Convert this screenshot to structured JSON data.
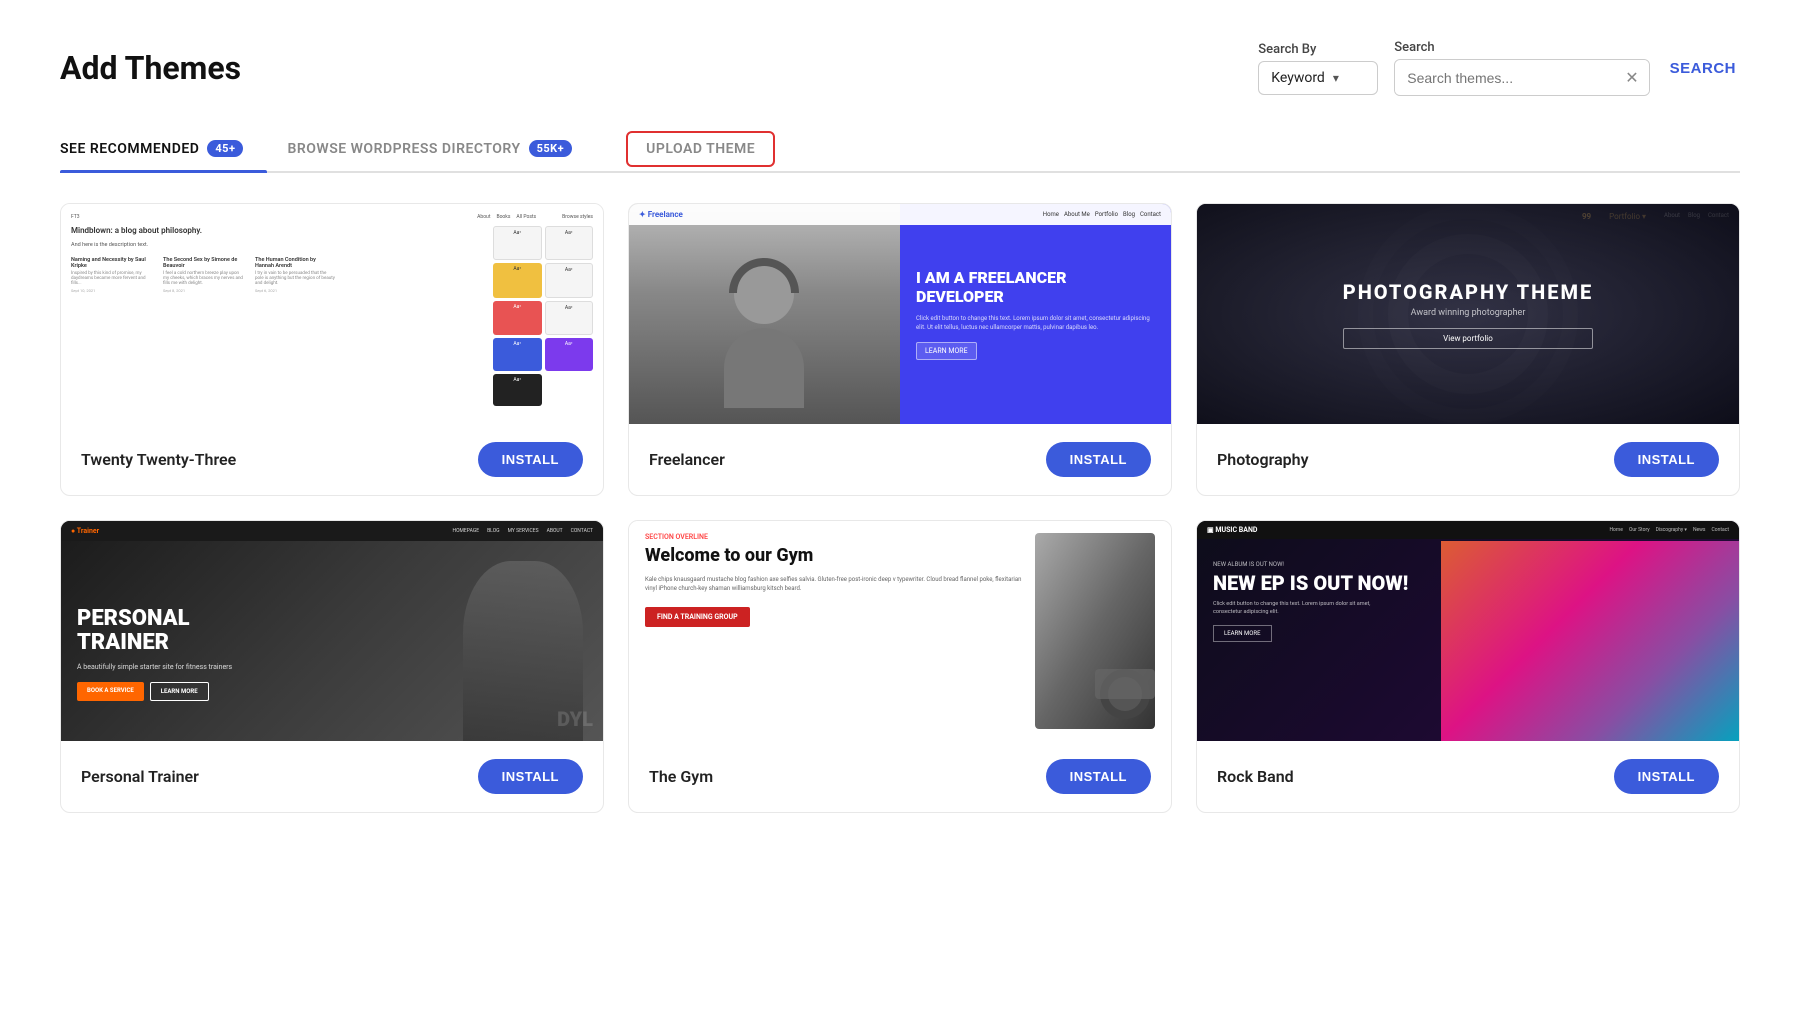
{
  "page": {
    "title": "Add Themes",
    "background": "#ffffff"
  },
  "header": {
    "search_by_label": "Search By",
    "keyword_label": "Keyword",
    "search_label": "Search",
    "search_placeholder": "Search themes...",
    "search_button": "SEARCH"
  },
  "tabs": [
    {
      "id": "recommended",
      "label": "SEE RECOMMENDED",
      "badge": "45+",
      "active": true
    },
    {
      "id": "wordpress",
      "label": "BROWSE WORDPRESS DIRECTORY",
      "badge": "55K+",
      "active": false
    },
    {
      "id": "upload",
      "label": "UPLOAD THEME",
      "badge": null,
      "active": false,
      "highlighted": true
    }
  ],
  "themes": [
    {
      "id": "twenty-twenty-three",
      "name": "Twenty Twenty-Three",
      "install_label": "INSTALL"
    },
    {
      "id": "freelancer",
      "name": "Freelancer",
      "install_label": "INSTALL"
    },
    {
      "id": "photography",
      "name": "Photography",
      "install_label": "INSTALL"
    },
    {
      "id": "personal-trainer",
      "name": "Personal Trainer",
      "install_label": "INSTALL"
    },
    {
      "id": "the-gym",
      "name": "The Gym",
      "install_label": "INSTALL"
    },
    {
      "id": "rock-band",
      "name": "Rock Band",
      "install_label": "INSTALL"
    }
  ],
  "freelancer_preview": {
    "nav_logo": "Freelance",
    "nav_links": [
      "Home",
      "About Me",
      "Portfolio",
      "Blog",
      "Contact"
    ],
    "headline": "I AM A FREELANCER DEVELOPER",
    "body": "Click edit button to change this text. Lorem ipsum dolor sit amet, consectetur adipiscing elit.",
    "cta": "LEARN MORE"
  },
  "photography_preview": {
    "nav_links": [
      "Portfolio",
      "About",
      "Blog",
      "Contact"
    ],
    "headline": "PHOTOGRAPHY THEME",
    "sub": "Award winning photographer",
    "cta": "View portfolio"
  },
  "trainer_preview": {
    "logo": "Trainer",
    "nav_links": [
      "HOMEPAGE",
      "BLOG",
      "MY SERVICES",
      "ABOUT",
      "CONTACT"
    ],
    "headline": "PERSONAL TRAINER",
    "sub": "A beautifully simple starter site for fitness trainers",
    "btn1": "BOOK A SERVICE",
    "btn2": "LEARN MORE"
  },
  "gym_preview": {
    "overline": "SECTION OVERLINE",
    "headline": "Welcome to our Gym",
    "body": "Kale chips knausgaard mustache blog fashion axe selfies salvia. Gluten-free post-ironic deep v typewriter. Cloud bread flannel poke, flexitarian vinyl iPhone church-key shaman williamsburg kitsch beard.",
    "cta": "FIND A TRAINING GROUP"
  },
  "rockband_preview": {
    "logo": "MUSIC BAND",
    "nav_links": [
      "Home",
      "Our Story",
      "Discography",
      "News",
      "Contact"
    ],
    "small": "NEW ALBUM IS OUT NOW!",
    "headline": "NEW EP IS OUT NOW!",
    "body": "Click edit button to change this text. Lorem ipsum dolor sit amet, consectetur adipiscing elit.",
    "cta": "LEARN MORE"
  }
}
